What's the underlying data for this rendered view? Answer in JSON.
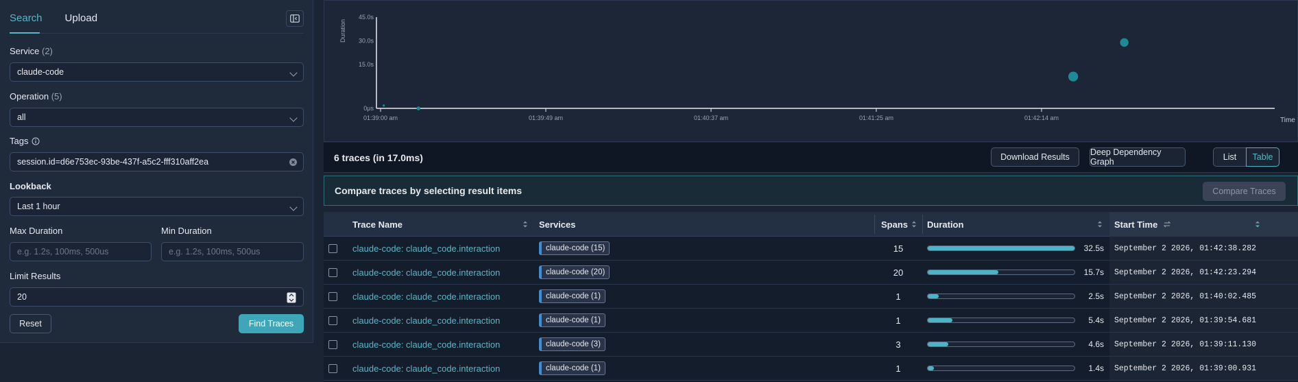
{
  "sidebar": {
    "tabs": [
      {
        "label": "Search",
        "active": true
      },
      {
        "label": "Upload",
        "active": false
      }
    ],
    "service": {
      "label": "Service",
      "count": "(2)",
      "value": "claude-code"
    },
    "operation": {
      "label": "Operation",
      "count": "(5)",
      "value": "all"
    },
    "tags": {
      "label": "Tags",
      "value": "session.id=d6e753ec-93be-437f-a5c2-fff310aff2ea"
    },
    "lookback": {
      "label": "Lookback",
      "value": "Last 1 hour"
    },
    "max_duration": {
      "label": "Max Duration",
      "placeholder": "e.g. 1.2s, 100ms, 500us"
    },
    "min_duration": {
      "label": "Min Duration",
      "placeholder": "e.g. 1.2s, 100ms, 500us"
    },
    "limit": {
      "label": "Limit Results",
      "value": "20"
    },
    "reset_label": "Reset",
    "find_label": "Find Traces"
  },
  "chart": {
    "ylabel": "Duration",
    "xlabel": "Time",
    "yticks": [
      "45.0s",
      "30.0s",
      "15.0s",
      "0μs"
    ],
    "xticks": [
      "01:39:00 am",
      "01:39:49 am",
      "01:40:37 am",
      "01:41:25 am",
      "01:42:14 am"
    ]
  },
  "chart_data": {
    "type": "scatter",
    "xlabel": "Time",
    "ylabel": "Duration",
    "ylim": [
      0,
      45
    ],
    "x_ticks": [
      "01:39:00 am",
      "01:39:49 am",
      "01:40:37 am",
      "01:41:25 am",
      "01:42:14 am"
    ],
    "points": [
      {
        "x": "01:39:00.931",
        "y": 1.4,
        "spans": 1
      },
      {
        "x": "01:39:11.130",
        "y": 0.0,
        "spans": 3
      },
      {
        "x": "01:42:23.294",
        "y": 15.7,
        "spans": 20
      },
      {
        "x": "01:42:38.282",
        "y": 32.5,
        "spans": 15
      }
    ],
    "color": "#1f8a96"
  },
  "summary": {
    "trace_count": "6 traces (in 17.0ms)",
    "download_label": "Download Results",
    "ddg_label": "Deep Dependency Graph",
    "list_label": "List",
    "table_label": "Table"
  },
  "compare": {
    "text": "Compare traces by selecting result items",
    "button": "Compare Traces"
  },
  "table": {
    "headers": {
      "name": "Trace Name",
      "services": "Services",
      "spans": "Spans",
      "duration": "Duration",
      "start": "Start Time"
    },
    "rows": [
      {
        "name": "claude-code: claude_code.interaction",
        "service": "claude-code (15)",
        "spans": "15",
        "duration": "32.5s",
        "fraction": 1.0,
        "start": "September 2 2026, 01:42:38.282"
      },
      {
        "name": "claude-code: claude_code.interaction",
        "service": "claude-code (20)",
        "spans": "20",
        "duration": "15.7s",
        "fraction": 0.48,
        "start": "September 2 2026, 01:42:23.294"
      },
      {
        "name": "claude-code: claude_code.interaction",
        "service": "claude-code (1)",
        "spans": "1",
        "duration": "2.5s",
        "fraction": 0.077,
        "start": "September 2 2026, 01:40:02.485"
      },
      {
        "name": "claude-code: claude_code.interaction",
        "service": "claude-code (1)",
        "spans": "1",
        "duration": "5.4s",
        "fraction": 0.166,
        "start": "September 2 2026, 01:39:54.681"
      },
      {
        "name": "claude-code: claude_code.interaction",
        "service": "claude-code (3)",
        "spans": "3",
        "duration": "4.6s",
        "fraction": 0.142,
        "start": "September 2 2026, 01:39:11.130"
      },
      {
        "name": "claude-code: claude_code.interaction",
        "service": "claude-code (1)",
        "spans": "1",
        "duration": "1.4s",
        "fraction": 0.043,
        "start": "September 2 2026, 01:39:00.931"
      }
    ]
  }
}
